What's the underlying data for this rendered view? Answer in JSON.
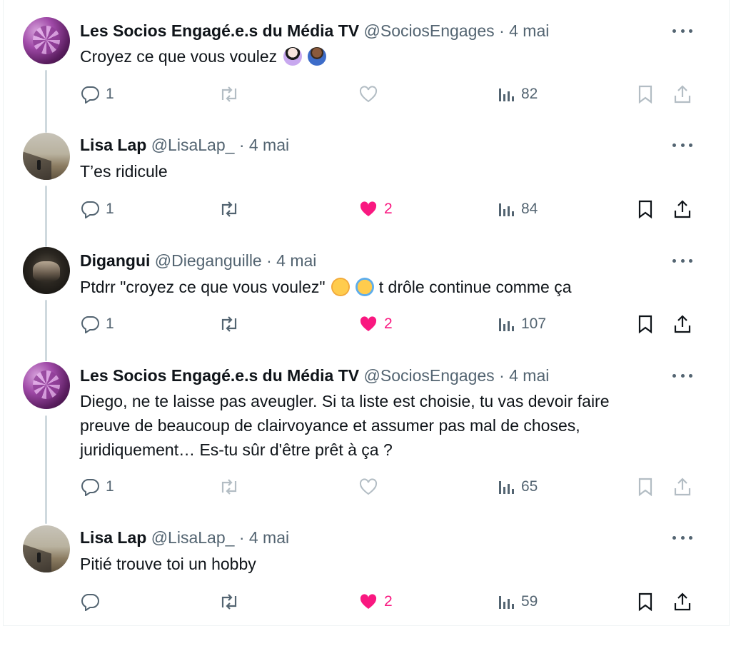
{
  "tweets": [
    {
      "name": "Les Socios Engagé.e.s du Média TV",
      "handle": "@SociosEngages",
      "date": "· 4 mai",
      "text": "Croyez ce que vous voulez",
      "replies": "1",
      "likes": "",
      "liked": false,
      "views": "82"
    },
    {
      "name": "Lisa Lap",
      "handle": "@LisaLap_",
      "date": "· 4 mai",
      "text": "T’es ridicule",
      "replies": "1",
      "likes": "2",
      "liked": true,
      "views": "84"
    },
    {
      "name": "Digangui",
      "handle": "@Dieganguille",
      "date": "· 4 mai",
      "text": "Ptdrr \"croyez ce que vous voulez\"",
      "text_after": "t drôle continue comme ça",
      "replies": "1",
      "likes": "2",
      "liked": true,
      "views": "107"
    },
    {
      "name": "Les Socios Engagé.e.s du Média TV",
      "handle": "@SociosEngages",
      "date": "· 4 mai",
      "text_lines": [
        "Diego, ne te laisse pas aveugler. Si ta liste est choisie, tu vas devoir faire",
        "preuve de beaucoup de clairvoyance et assumer pas mal de choses,",
        "juridiquement… Es-tu sûr d'être prêt à ça ?"
      ],
      "replies": "1",
      "likes": "",
      "liked": false,
      "views": "65"
    },
    {
      "name": "Lisa Lap",
      "handle": "@LisaLap_",
      "date": "· 4 mai",
      "text": "Pitié trouve toi un hobby",
      "replies": "",
      "likes": "2",
      "liked": true,
      "views": "59"
    }
  ],
  "icons": {
    "reply": "reply-icon",
    "retweet": "retweet-icon",
    "like": "heart-icon",
    "views": "views-icon",
    "bookmark": "bookmark-icon",
    "share": "share-icon",
    "more": "more-icon"
  },
  "colors": {
    "like_active": "#f91880",
    "secondary_text": "#536471",
    "thread_line": "#cfd9de"
  }
}
